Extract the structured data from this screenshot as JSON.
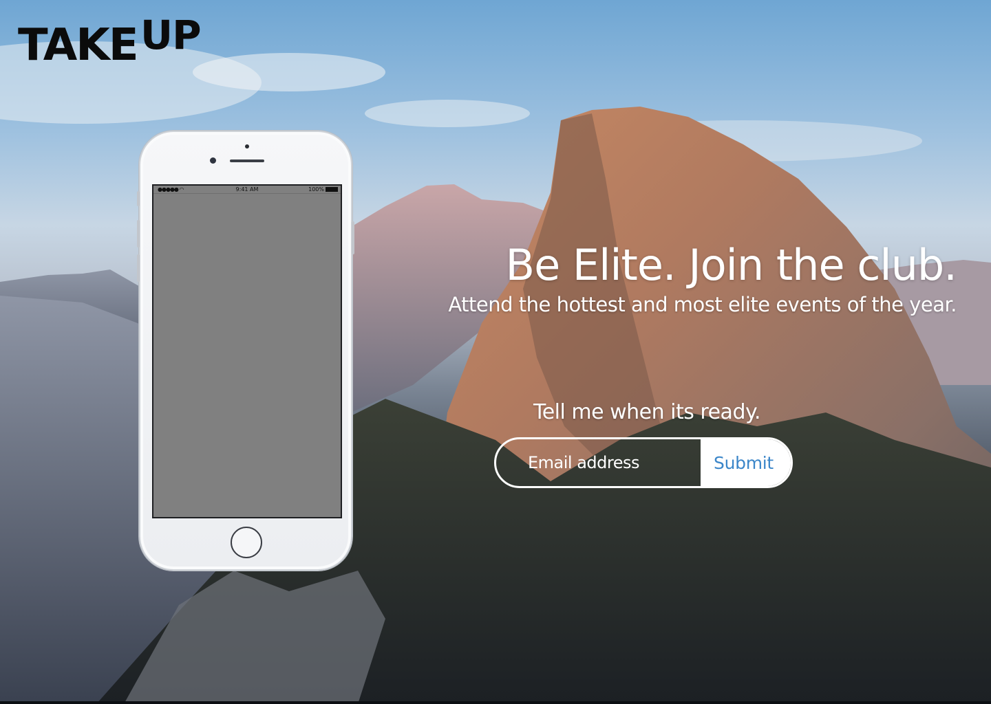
{
  "brand": {
    "word_main": "TAKE",
    "word_super": "UP"
  },
  "phone": {
    "status_signal": "●●●●● ",
    "status_time": "9:41 AM",
    "status_battery": "100%"
  },
  "hero": {
    "headline": "Be Elite. Join the club.",
    "subheadline": "Attend the hottest and most elite events of the year."
  },
  "signup": {
    "prompt": "Tell me when its ready.",
    "email_placeholder": "Email address",
    "email_value": "",
    "submit_label": "Submit"
  },
  "colors": {
    "submit_text": "#3b86c9",
    "screen_gray": "#808080",
    "logo": "#0b0b0b"
  },
  "icons": [
    "wifi-icon",
    "battery-icon",
    "home-button-icon"
  ]
}
